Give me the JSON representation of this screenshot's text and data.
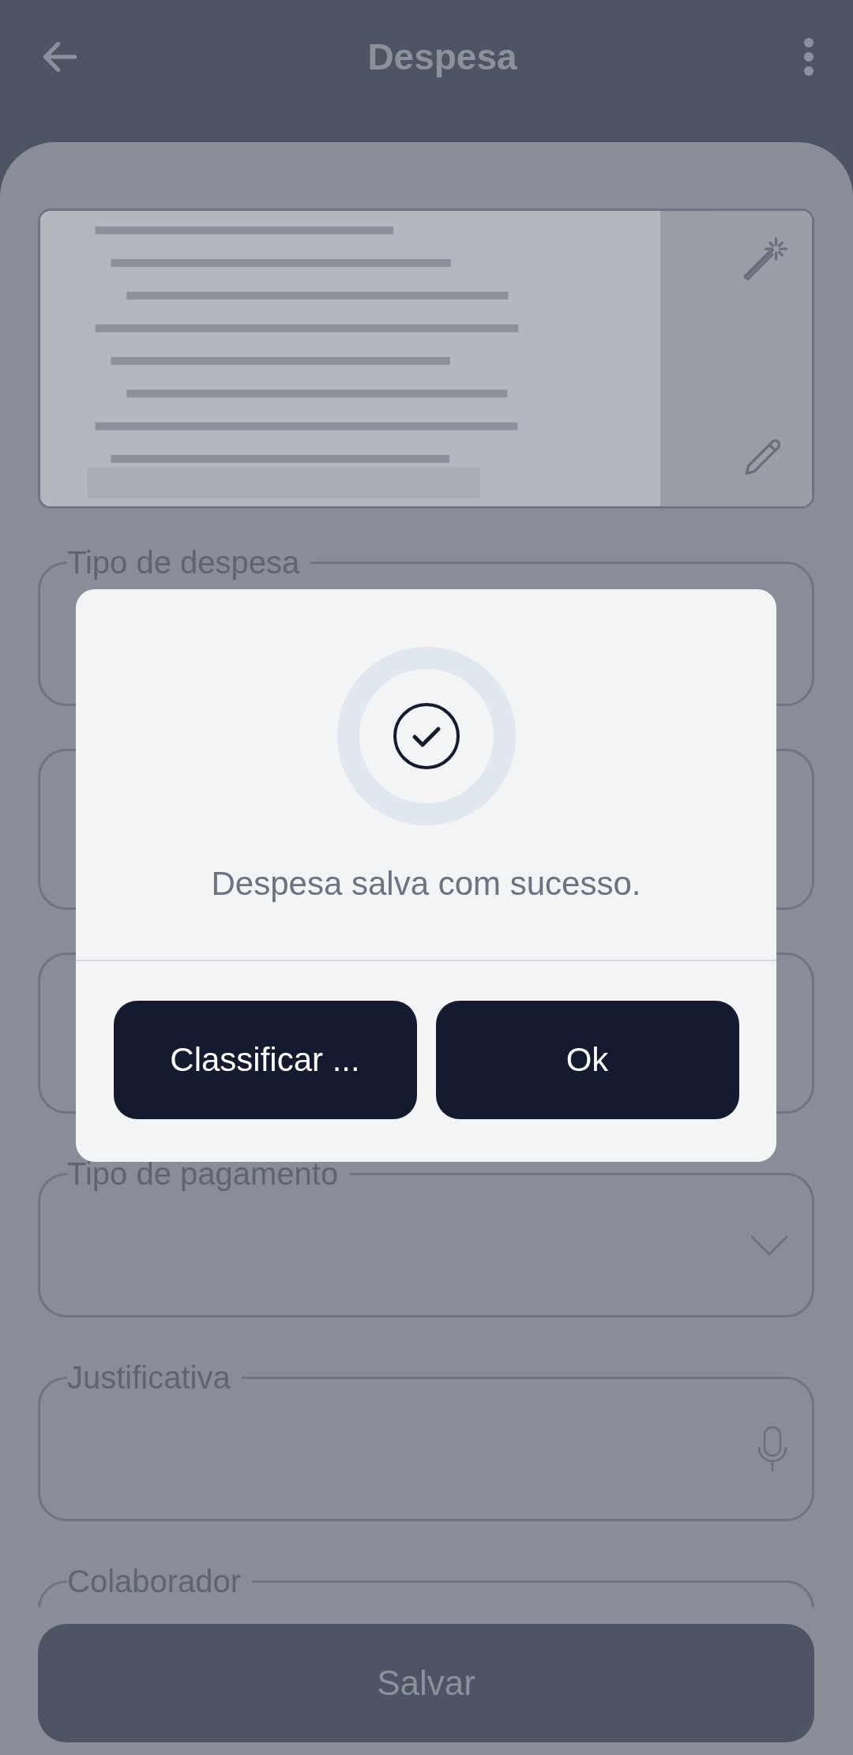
{
  "header": {
    "title": "Despesa"
  },
  "fields": [
    {
      "label": "Tipo de despesa",
      "kind": "text"
    },
    {
      "kind": "text"
    },
    {
      "kind": "text"
    },
    {
      "label": "Tipo de pagamento",
      "kind": "select"
    },
    {
      "label": "Justificativa",
      "kind": "voice"
    },
    {
      "label": "Colaborador",
      "kind": "text"
    }
  ],
  "save_button": "Salvar",
  "dialog": {
    "message": "Despesa salva com sucesso.",
    "buttons": [
      "Classificar ...",
      "Ok"
    ]
  }
}
